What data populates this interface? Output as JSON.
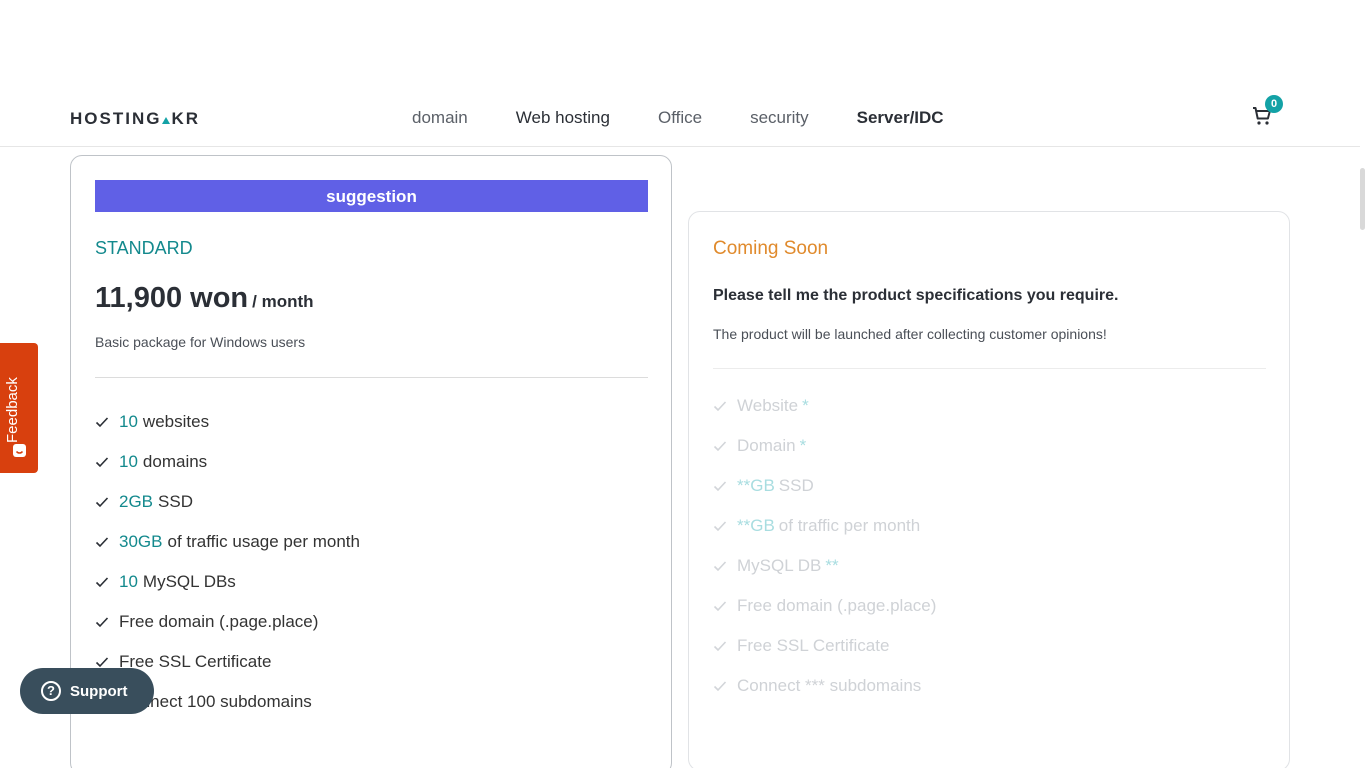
{
  "header": {
    "logo": "HOSTING.KR",
    "nav": [
      "domain",
      "Web hosting",
      "Office",
      "security",
      "Server/IDC"
    ],
    "cart_count": "0"
  },
  "plan": {
    "badge": "suggestion",
    "name": "STANDARD",
    "price": "11,900 won",
    "period": "/ month",
    "description": "Basic package for Windows users",
    "features": [
      {
        "highlight": "10",
        "text": "websites"
      },
      {
        "highlight": "10",
        "text": "domains"
      },
      {
        "highlight": "2GB",
        "text": "SSD"
      },
      {
        "highlight": "30GB",
        "text": "of traffic usage per month"
      },
      {
        "highlight": "10",
        "text": "MySQL DBs"
      },
      {
        "highlight": "",
        "text": "Free domain (.page.place)"
      },
      {
        "highlight": "",
        "text": "Free SSL Certificate"
      },
      {
        "highlight": "",
        "text": "Connect 100 subdomains"
      }
    ]
  },
  "coming_soon": {
    "title": "Coming Soon",
    "question": "Please tell me the product specifications you require.",
    "note": "The product will be launched after collecting customer opinions!",
    "features": [
      {
        "pre": "",
        "text": "Website",
        "hl": "*"
      },
      {
        "pre": "",
        "text": "Domain",
        "hl": "*"
      },
      {
        "pre": "**GB",
        "text": "SSD",
        "hl": ""
      },
      {
        "pre": "**GB",
        "text": "of traffic per month",
        "hl": ""
      },
      {
        "pre": "",
        "text": "MySQL DB",
        "hl": "**"
      },
      {
        "pre": "",
        "text": "Free domain (.page.place)",
        "hl": ""
      },
      {
        "pre": "",
        "text": "Free SSL Certificate",
        "hl": ""
      },
      {
        "pre": "",
        "text": "Connect *** subdomains",
        "hl": ""
      }
    ]
  },
  "feedback": {
    "label": "Feedback"
  },
  "support": {
    "label": "Support"
  },
  "colors": {
    "accent": "#13898d",
    "badge": "#6060e6",
    "coming_soon": "#e08a2c",
    "feedback": "#d8400e",
    "support": "#394e5c"
  }
}
